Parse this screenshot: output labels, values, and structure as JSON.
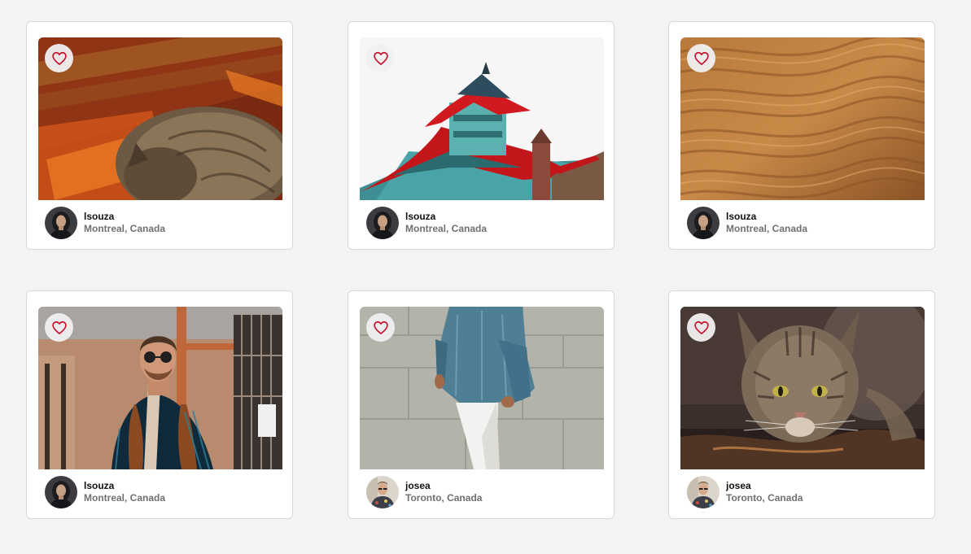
{
  "colors": {
    "background": "#f3f3f3",
    "card": "#ffffff",
    "heart": "#c8102e",
    "location_text": "#707070"
  },
  "cards": [
    {
      "photo_subject": "cat-on-rug",
      "favorite_icon": "heart-outline-icon",
      "author": {
        "name": "lsouza",
        "location": "Montreal, Canada",
        "avatar": "woman-portrait"
      }
    },
    {
      "photo_subject": "pagoda-building",
      "favorite_icon": "heart-outline-icon",
      "author": {
        "name": "lsouza",
        "location": "Montreal, Canada",
        "avatar": "woman-portrait"
      }
    },
    {
      "photo_subject": "sand-dunes",
      "favorite_icon": "heart-outline-icon",
      "author": {
        "name": "lsouza",
        "location": "Montreal, Canada",
        "avatar": "woman-portrait"
      }
    },
    {
      "photo_subject": "man-with-sunglasses",
      "favorite_icon": "heart-outline-icon",
      "author": {
        "name": "lsouza",
        "location": "Montreal, Canada",
        "avatar": "woman-portrait"
      }
    },
    {
      "photo_subject": "person-in-denim-walking",
      "favorite_icon": "heart-outline-icon",
      "author": {
        "name": "josea",
        "location": "Toronto, Canada",
        "avatar": "man-portrait"
      }
    },
    {
      "photo_subject": "cat-drinking-water",
      "favorite_icon": "heart-outline-icon",
      "author": {
        "name": "josea",
        "location": "Toronto, Canada",
        "avatar": "man-portrait"
      }
    }
  ]
}
